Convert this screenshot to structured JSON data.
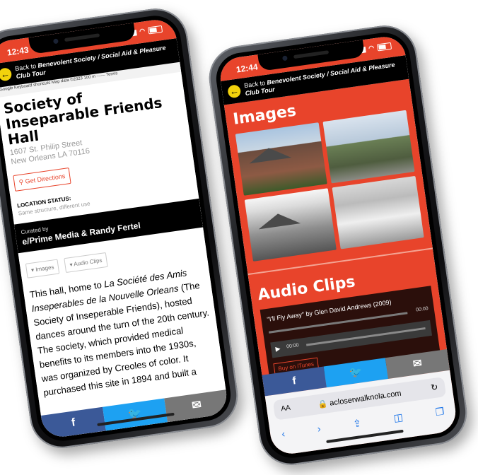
{
  "phone1": {
    "time": "12:43",
    "back_prefix": "Back to ",
    "back_link": "Benevolent Society / Social Aid & Pleasure Club Tour",
    "map_strip": "Google  Keyboard shortcuts   Map data ©2023   100 m ⎯⎯⎯⎯   Terms",
    "title": "Society of Inseparable Friends Hall",
    "address_line1": "1607 St. Philip Street",
    "address_line2": "New Orleans LA 70116",
    "directions_label": "Get Directions",
    "location_status_label": "LOCATION STATUS:",
    "location_status_value": "Same structure, different use",
    "curated_label": "Curated by",
    "curated_value": "e/Prime Media & Randy Fertel",
    "pill_images": "Images",
    "pill_audio": "Audio Clips",
    "body_pre": "This hall, home to ",
    "body_italic": "La Société des Amis Inseperables de la Nouvelle Orleans",
    "body_post": " (The Society of Inseperable Friends), hosted dances around the turn of the 20th century. The society, which provided medical benefits to its members into the 1930s, was organized by Creoles of color. It purchased this site in 1894 and built a",
    "share": {
      "facebook": "f",
      "twitter": "🐦",
      "email": "✉"
    }
  },
  "phone2": {
    "time": "12:44",
    "back_prefix": "Back to ",
    "back_link": "Benevolent Society / Social Aid & Pleasure Club Tour",
    "images_heading": "Images",
    "audio_heading": "Audio Clips",
    "audio_title": "\"I'll Fly Away\" by Glen David Andrews (2009)",
    "track_time": "00:00",
    "player_time": "00:00",
    "buy_label": "Buy on iTunes",
    "share": {
      "facebook": "f",
      "twitter": "🐦",
      "email": "✉"
    },
    "browser": {
      "aa": "AA",
      "host": "acloserwalknola.com",
      "reload": "↻"
    }
  },
  "colors": {
    "accent": "#e8442b",
    "facebook": "#3b5998",
    "twitter": "#1da1f2",
    "email": "#777777"
  }
}
